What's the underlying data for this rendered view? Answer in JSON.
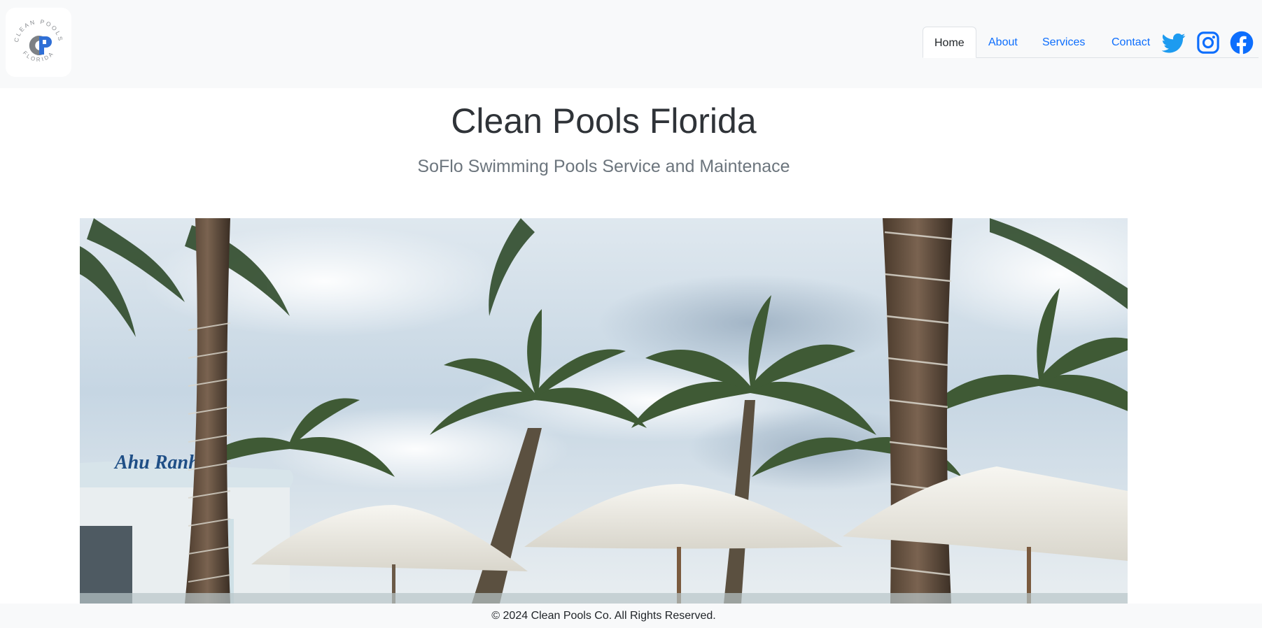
{
  "header": {
    "logo": {
      "ring_text_top": "CLEAN POOLS",
      "ring_text_bottom": "FLORIDA",
      "mark": "CP"
    },
    "nav": [
      {
        "label": "Home",
        "active": true
      },
      {
        "label": "About",
        "active": false
      },
      {
        "label": "Services",
        "active": false
      },
      {
        "label": "Contact",
        "active": false
      }
    ],
    "social": [
      {
        "icon": "twitter-icon",
        "color": "#1d9bf0"
      },
      {
        "icon": "instagram-icon",
        "color": "#0d6efd"
      },
      {
        "icon": "facebook-icon",
        "color": "#0d6efd"
      }
    ]
  },
  "hero": {
    "title": "Clean Pools Florida",
    "subtitle": "SoFlo Swimming Pools Service and Maintenace"
  },
  "footer": {
    "text": "© 2024 Clean Pools Co. All Rights Reserved."
  }
}
